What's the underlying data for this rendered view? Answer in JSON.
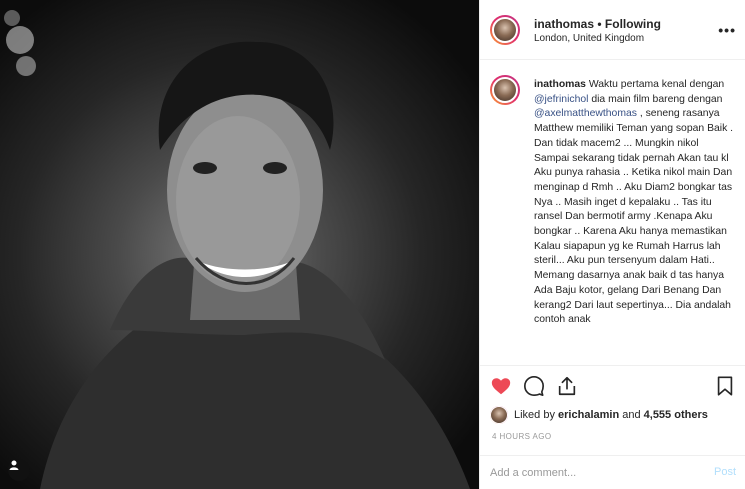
{
  "post": {
    "username": "inathomas",
    "separator": "•",
    "follow_status": "Following",
    "location": "London, United Kingdom",
    "more_label": "•••"
  },
  "caption": {
    "username": "inathomas",
    "text_1": " Waktu pertama kenal dengan ",
    "mention_1": "@jefrinichol",
    "text_2": " dia main film bareng dengan ",
    "mention_2": "@axelmatthewthomas",
    "text_3": " , seneng rasanya Matthew memiliki Teman yang sopan Baik . Dan tidak macem2 ... Mungkin nikol Sampai sekarang tidak pernah Akan tau kl Aku punya rahasia .. Ketika nikol main Dan menginap d Rmh .. Aku Diam2 bongkar tas Nya .. Masih inget d kepalaku .. Tas itu ransel Dan bermotif army .Kenapa Aku bongkar .. Karena Aku hanya memastikan Kalau siapapun yg ke Rumah Harrus lah steril... Aku pun tersenyum dalam Hati.. Memang dasarnya anak baik d tas hanya Ada Baju kotor, gelang Dari Benang Dan kerang2 Dari laut sepertinya... Dia andalah contoh anak"
  },
  "likes": {
    "prefix": "Liked by ",
    "user": "erichalamin",
    "middle": " and ",
    "count": "4,555 others"
  },
  "timestamp": "4 HOURS AGO",
  "comment": {
    "placeholder": "Add a comment...",
    "post_label": "Post"
  },
  "colors": {
    "like_red": "#ed4956",
    "mention_blue": "#385185",
    "post_disabled": "#b2dffc"
  },
  "icons": {
    "like": "heart-icon",
    "comment": "comment-icon",
    "share": "share-icon",
    "save": "bookmark-icon",
    "user_tag": "user-tag-icon"
  }
}
